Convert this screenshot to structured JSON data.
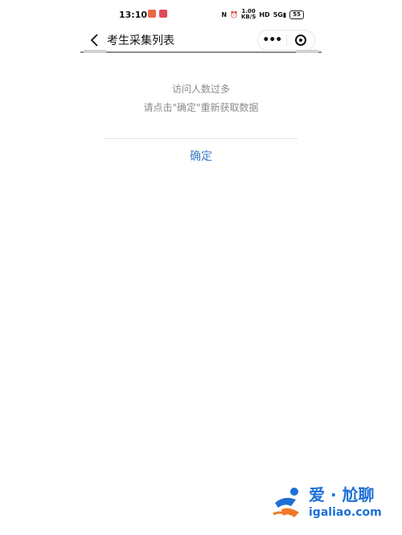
{
  "status_bar": {
    "time": "13:10",
    "net_speed_value": "1.00",
    "net_speed_unit": "KB/S",
    "hd": "HD",
    "signal": "5G",
    "battery": "55",
    "icons": [
      "app-notification-icon",
      "app-notification-icon",
      "nfc-icon",
      "alarm-icon",
      "hd-icon",
      "signal-icon",
      "battery-icon"
    ]
  },
  "nav": {
    "title": "考生采集列表",
    "back_icon": "chevron-left-icon",
    "more_label": "•••",
    "close_icon": "target-icon"
  },
  "dialog": {
    "title": "访问人数过多",
    "message": "请点击\"确定\"重新获取数据",
    "confirm_label": "确定"
  },
  "watermark": {
    "name": "爱 · 尬聊",
    "url": "igaliao.com"
  },
  "colors": {
    "accent": "#3e7ac4",
    "watermark": "#1d6fd6",
    "text_muted": "#8a8a8a"
  }
}
